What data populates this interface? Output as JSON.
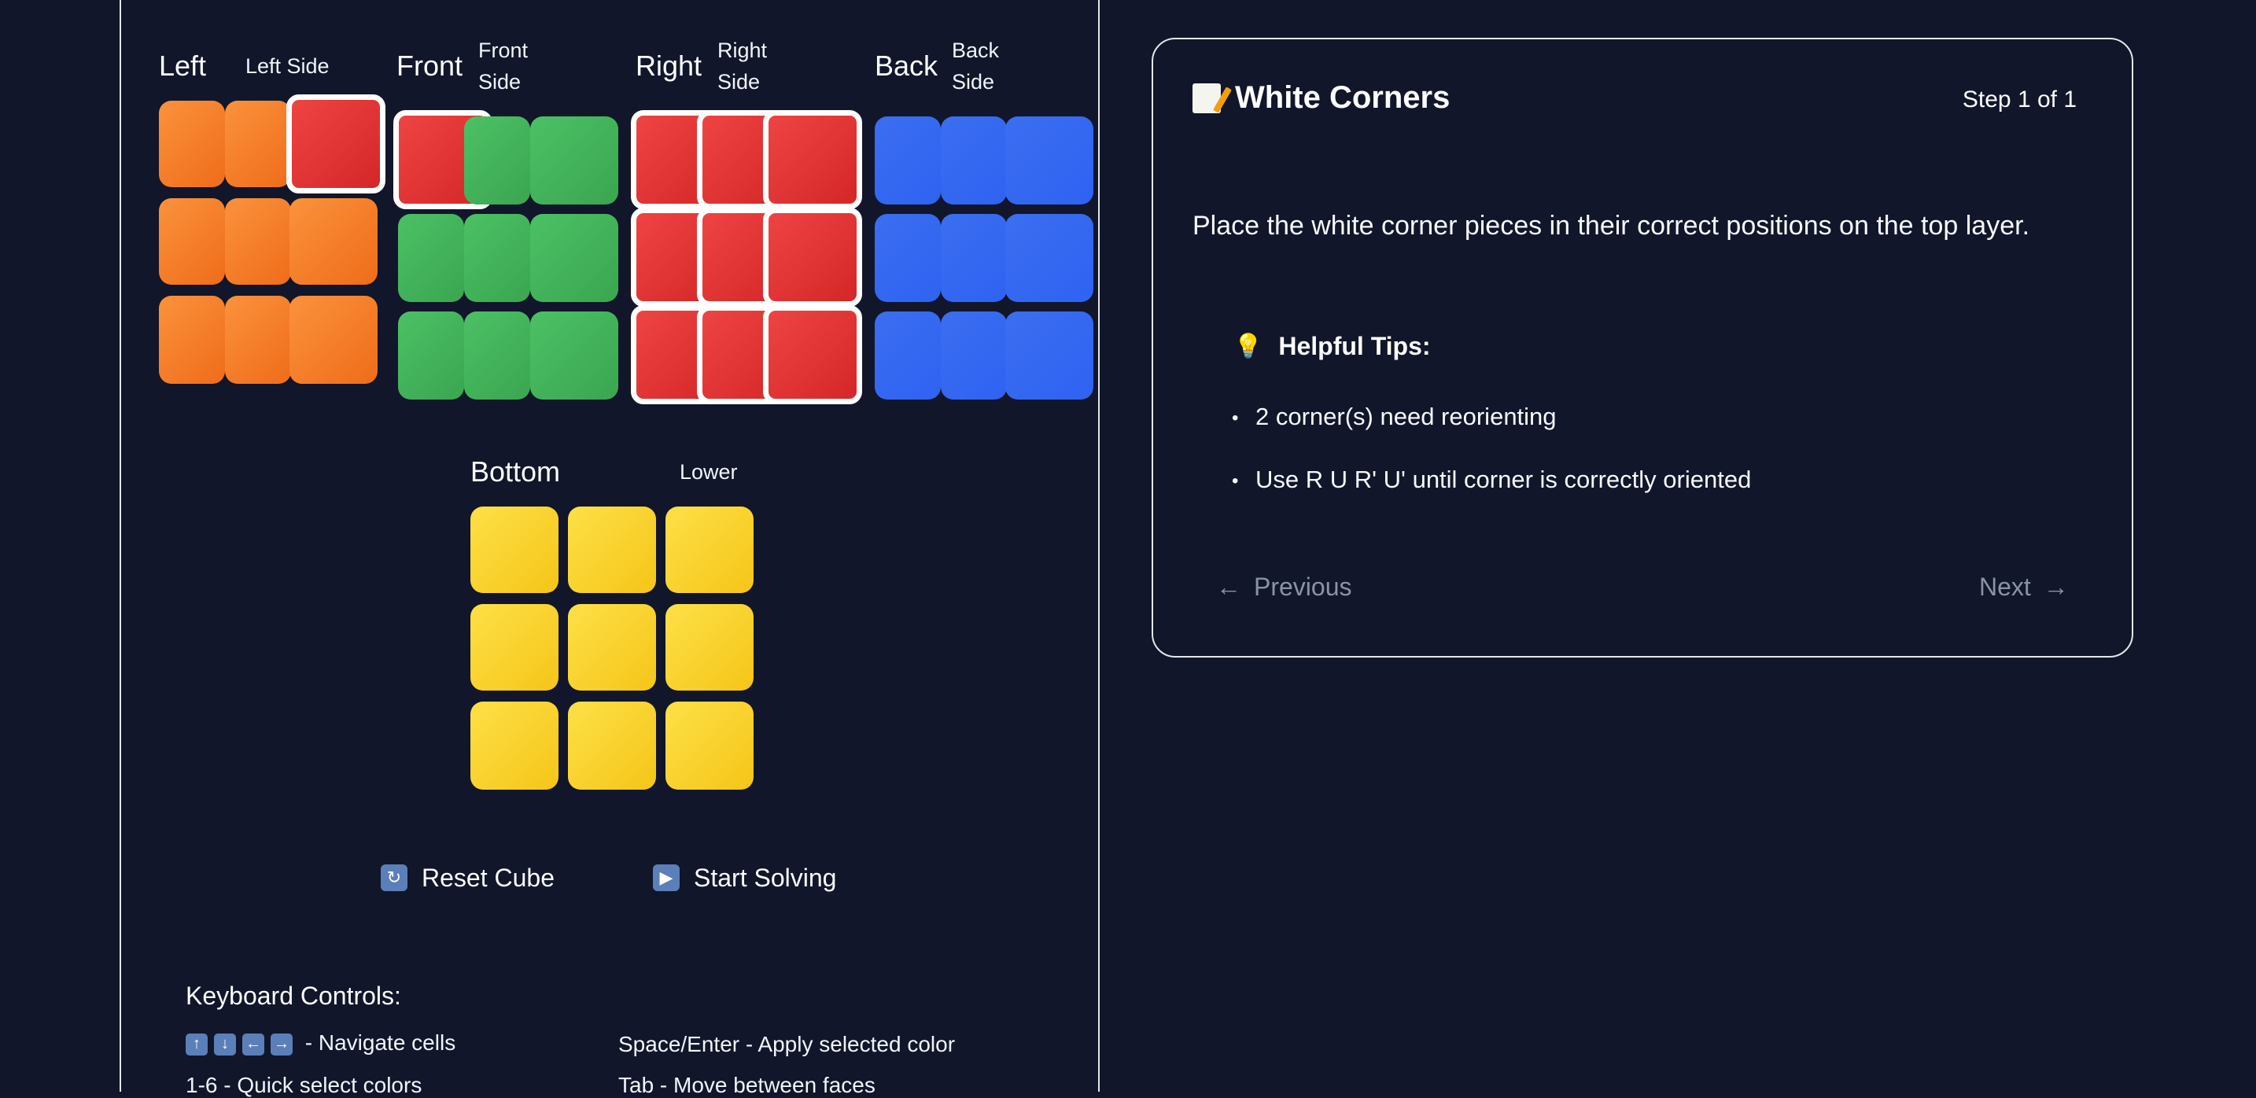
{
  "faces": {
    "left": {
      "label": "Left",
      "sub": "Left Side",
      "colors": [
        "orange",
        "orange",
        "red",
        "orange",
        "orange",
        "orange",
        "orange",
        "orange",
        "orange"
      ]
    },
    "front": {
      "label": "Front",
      "sub_line1": "Front",
      "sub_line2": "Side",
      "colors": [
        "red",
        "green",
        "green",
        "green",
        "green",
        "green",
        "green",
        "green",
        "green"
      ]
    },
    "right": {
      "label": "Right",
      "sub_line1": "Right",
      "sub_line2": "Side",
      "colors": [
        "red",
        "red",
        "red",
        "red",
        "red",
        "red",
        "red",
        "red",
        "red"
      ]
    },
    "back": {
      "label": "Back",
      "sub_line1": "Back",
      "sub_line2": "Side",
      "colors": [
        "blue",
        "blue",
        "blue",
        "blue",
        "blue",
        "blue",
        "blue",
        "blue",
        "blue"
      ]
    },
    "bottom": {
      "label": "Bottom",
      "sub": "Lower",
      "colors": [
        "yellow",
        "yellow",
        "yellow",
        "yellow",
        "yellow",
        "yellow",
        "yellow",
        "yellow",
        "yellow"
      ]
    }
  },
  "palette": {
    "orange": "#f47f2a",
    "red": "#e03232",
    "green": "#44b45c",
    "blue": "#3467f2",
    "yellow": "#f9d331"
  },
  "actions": {
    "reset_label": "Reset Cube",
    "reset_icon": "refresh-icon",
    "solve_label": "Start Solving",
    "solve_icon": "play-icon"
  },
  "keyboard": {
    "title": "Keyboard Controls:",
    "navigate": "- Navigate cells",
    "apply": "Space/Enter - Apply selected color",
    "quick": "1-6 - Quick select colors",
    "tab": "Tab - Move between faces"
  },
  "step_card": {
    "title": "White Corners",
    "step_indicator": "Step 1 of 1",
    "description": "Place the white corner pieces in their correct positions on the top layer.",
    "tips_title": "Helpful Tips:",
    "tips": [
      "2 corner(s) need reorienting",
      "Use R U R' U' until corner is correctly oriented"
    ],
    "prev_label": "Previous",
    "next_label": "Next"
  },
  "background_color": "#11162a"
}
